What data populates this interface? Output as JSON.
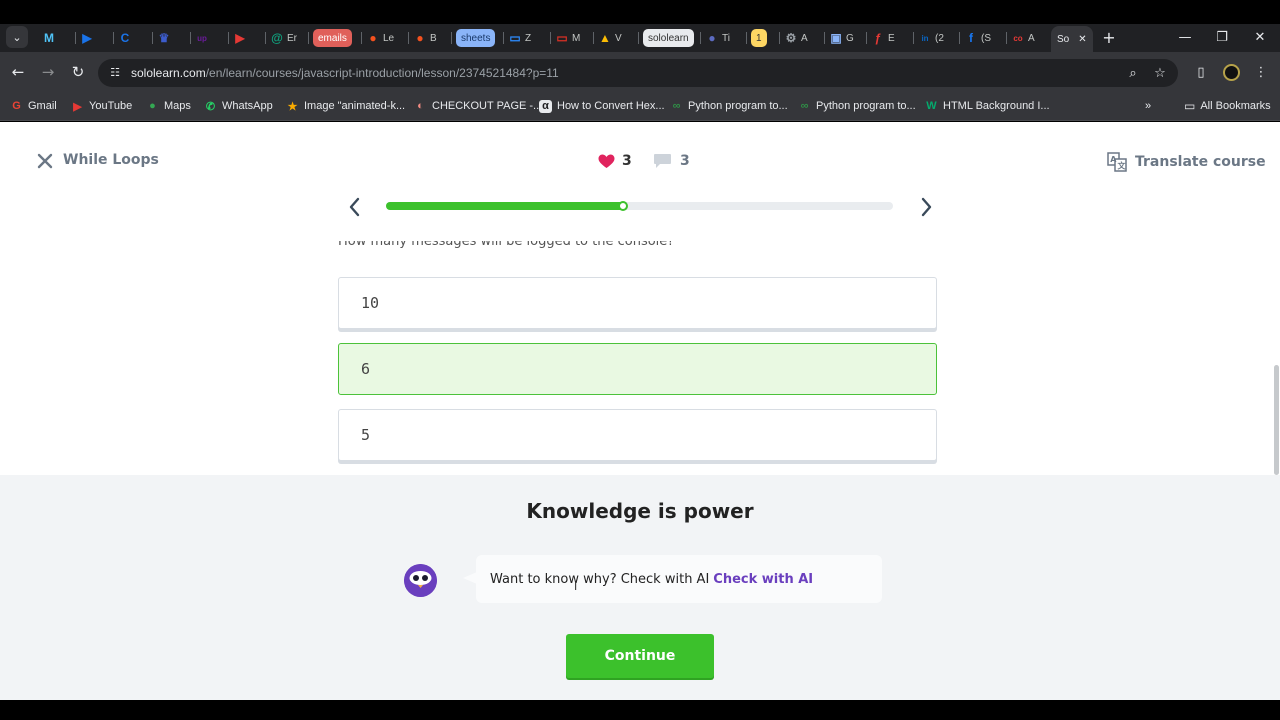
{
  "browser": {
    "tabs": [
      {
        "icon": "gmail-m-icon",
        "label": "",
        "color": "#4fc3f7",
        "glyph": "M"
      },
      {
        "icon": "play-icon",
        "label": "",
        "color": "#1a73e8",
        "glyph": "▶"
      },
      {
        "icon": "circle-c-icon",
        "label": "",
        "color": "#1a73e8",
        "glyph": "C"
      },
      {
        "icon": "crown-icon",
        "label": "",
        "color": "#3c5ccc",
        "glyph": "♛"
      },
      {
        "icon": "upwork-icon",
        "label": "",
        "color": "#6a1b9a",
        "glyph": "up"
      },
      {
        "icon": "youtube-icon",
        "label": "",
        "color": "#e53935",
        "glyph": "▶"
      },
      {
        "icon": "chatgpt-icon",
        "label": "Er",
        "color": "#10a37f",
        "glyph": "@"
      },
      {
        "icon": "emails-chip",
        "label": "emails",
        "chip": true,
        "chipColor": "#e0605a",
        "chipText": "#fff"
      },
      {
        "icon": "pin-icon",
        "label": "Le",
        "color": "#f4511e",
        "glyph": "●"
      },
      {
        "icon": "pin-icon",
        "label": "B",
        "color": "#f4511e",
        "glyph": "●"
      },
      {
        "icon": "sheets-chip",
        "label": "sheets",
        "chip": true,
        "chipColor": "#8ab4f8",
        "chipText": "#1a3a6b"
      },
      {
        "icon": "zoom-icon",
        "label": "Z",
        "color": "#2d8cff",
        "glyph": "▭"
      },
      {
        "icon": "mail-icon",
        "label": "M",
        "color": "#d93025",
        "glyph": "▭"
      },
      {
        "icon": "drive-icon",
        "label": "V",
        "color": "#fbbc04",
        "glyph": "▲"
      },
      {
        "icon": "sololearn-chip",
        "label": "sololearn",
        "chip": true,
        "chipColor": "#e8eaed",
        "chipText": "#333"
      },
      {
        "icon": "globe-icon",
        "label": "Ti",
        "color": "#5c6bc0",
        "glyph": "●"
      },
      {
        "icon": "badge-one",
        "label": "1",
        "chip": true,
        "chipColor": "#fdd663",
        "chipText": "#333"
      },
      {
        "icon": "openai-icon",
        "label": "A",
        "color": "#9aa0a6",
        "glyph": "⚙"
      },
      {
        "icon": "g-icon",
        "label": "G",
        "color": "#8ab4f8",
        "glyph": "▣"
      },
      {
        "icon": "acrobat-icon",
        "label": "E",
        "color": "#e53935",
        "glyph": "ƒ"
      },
      {
        "icon": "linkedin-icon",
        "label": "(2",
        "color": "#0a66c2",
        "glyph": "in"
      },
      {
        "icon": "facebook-icon",
        "label": "(S",
        "color": "#1877f2",
        "glyph": "f"
      },
      {
        "icon": "co-icon",
        "label": "A",
        "color": "#e53935",
        "glyph": "co"
      },
      {
        "icon": "sololearn-active",
        "label": "So",
        "active": true
      }
    ],
    "url_host": "sololearn.com",
    "url_path": "/en/learn/courses/javascript-introduction/lesson/2374521484?p=11",
    "bookmarks": [
      {
        "label": "Gmail",
        "icon": "google-icon",
        "color": "#ea4335",
        "glyph": "G"
      },
      {
        "label": "YouTube",
        "icon": "youtube-icon",
        "color": "#e53935",
        "glyph": "▶"
      },
      {
        "label": "Maps",
        "icon": "maps-icon",
        "color": "#34a853",
        "glyph": "●"
      },
      {
        "label": "WhatsApp",
        "icon": "whatsapp-icon",
        "color": "#25d366",
        "glyph": "✆"
      },
      {
        "label": "Image \"animated-k...",
        "icon": "star-icon",
        "color": "#f9ab00",
        "glyph": "★"
      },
      {
        "label": "CHECKOUT PAGE -...",
        "icon": "lips-icon",
        "color": "#f28b82",
        "glyph": "◐"
      },
      {
        "label": "How to Convert Hex...",
        "icon": "alpha-icon",
        "color": "#202124",
        "glyph": "α"
      },
      {
        "label": "Python program to...",
        "icon": "gfg-icon",
        "color": "#2f8d46",
        "glyph": "∞"
      },
      {
        "label": "Python program to...",
        "icon": "gfg-icon",
        "color": "#2f8d46",
        "glyph": "∞"
      },
      {
        "label": "HTML Background I...",
        "icon": "w3-icon",
        "color": "#04aa6d",
        "glyph": "W"
      }
    ],
    "all_bookmarks": "All Bookmarks"
  },
  "lesson": {
    "title": "While Loops",
    "likes": "3",
    "comments": "3",
    "translate": "Translate course",
    "progress": 0.47,
    "question": "How many messages will be logged to the console?",
    "options": [
      {
        "value": "10",
        "selected": false
      },
      {
        "value": "6",
        "selected": true
      },
      {
        "value": "5",
        "selected": false
      }
    ]
  },
  "panel": {
    "title": "Knowledge is power",
    "ai_text": "Want to know why? Check with AI",
    "ai_link": "Check with AI",
    "continue": "Continue"
  },
  "colors": {
    "accent_green": "#3cc12c",
    "ai_purple": "#6a3fbe",
    "heart_red": "#e0245e"
  }
}
